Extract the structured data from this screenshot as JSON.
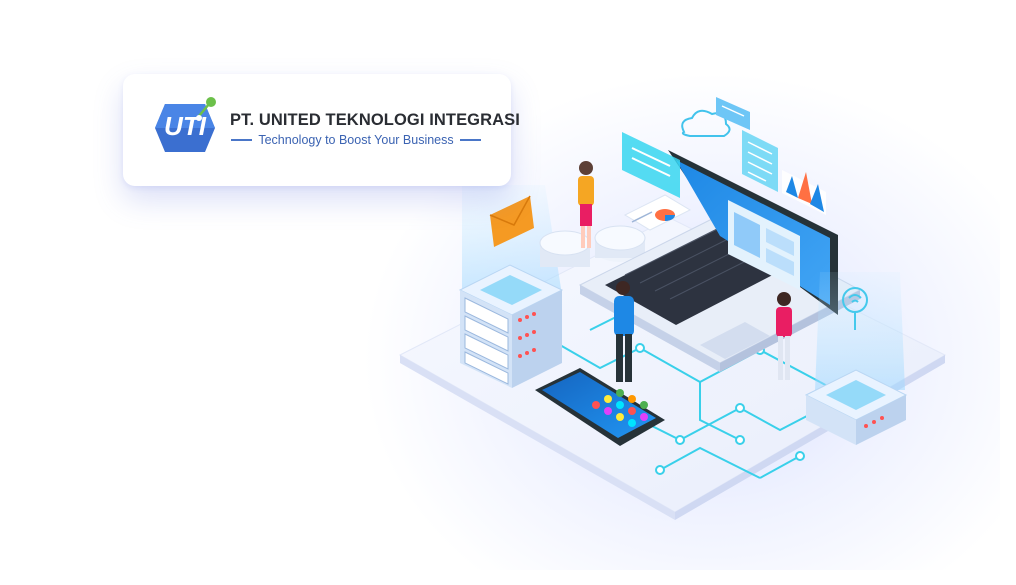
{
  "brand": {
    "logo_text": "UTI",
    "company_name": "PT. UNITED TEKNOLOGI INTEGRASI",
    "tagline": "Technology to Boost Your Business"
  },
  "illustration": {
    "icons": [
      "server-icon",
      "laptop-icon",
      "smartphone-icon",
      "envelope-icon",
      "cloud-icon",
      "pie-chart-icon",
      "bar-chart-icon",
      "database-icon",
      "wifi-icon",
      "person-icon"
    ]
  },
  "colors": {
    "brand_blue": "#3b6fd0",
    "brand_green": "#6cc04a",
    "cyan_accent": "#2fd3ee",
    "screen_blue": "#2196f3"
  }
}
